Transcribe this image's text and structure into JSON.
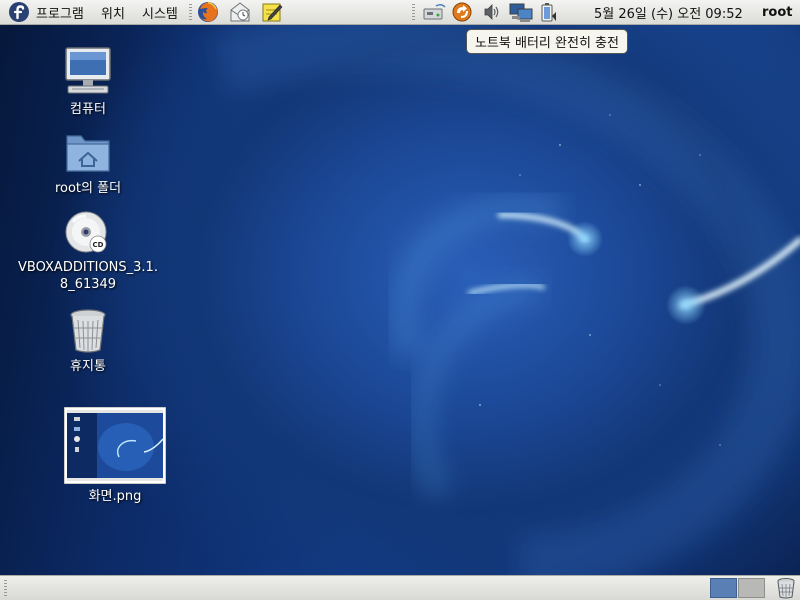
{
  "top_panel": {
    "menus": [
      {
        "label": "프로그램"
      },
      {
        "label": "위치"
      },
      {
        "label": "시스템"
      }
    ],
    "launchers": [
      {
        "icon": "firefox-icon"
      },
      {
        "icon": "mail-icon"
      },
      {
        "icon": "notes-icon"
      }
    ],
    "tray": [
      {
        "icon": "network-icon"
      },
      {
        "icon": "update-icon"
      },
      {
        "icon": "volume-icon"
      },
      {
        "icon": "network-connection-icon"
      },
      {
        "icon": "battery-icon"
      }
    ],
    "clock": "5월 26일 (수) 오전 09:52",
    "user": "root"
  },
  "tooltip": {
    "text": "노트북 배터리 완전히 충전"
  },
  "desktop": {
    "icons": [
      {
        "label": "컴퓨터",
        "icon": "computer-icon"
      },
      {
        "label": "root의 폴더",
        "icon": "home-folder-icon"
      },
      {
        "label": "VBOXADDITIONS_3.1.8_61349",
        "icon": "cd-icon"
      },
      {
        "label": "휴지통",
        "icon": "trash-icon"
      },
      {
        "label": "화면.png",
        "icon": "image-thumbnail-icon"
      }
    ]
  },
  "bottom_panel": {
    "workspaces": [
      {
        "active": true
      },
      {
        "active": false
      }
    ],
    "trash": {
      "icon": "trash-icon"
    }
  },
  "colors": {
    "panel": "#e8e8e4",
    "desktop_blue": "#123a85",
    "workspace_active": "#5a7fb4"
  }
}
